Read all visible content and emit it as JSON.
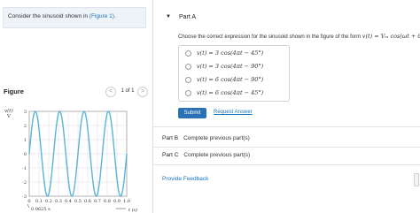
{
  "intro": {
    "text_before": "Consider the sinusoid shown in ",
    "figure_link": "(Figure 1)",
    "text_after": "."
  },
  "figure": {
    "title": "Figure",
    "pager_prev": "<",
    "pager_label": "1 of 1",
    "pager_next": ">"
  },
  "chart_data": {
    "type": "line",
    "ylabel_top": "v(t)",
    "ylabel_unit": "V",
    "xlabel": "t (s)",
    "xlim": [
      0,
      1.0
    ],
    "ylim": [
      -3,
      3
    ],
    "x_ticks": [
      "0",
      "0.1",
      "0.2",
      "0.3",
      "0.4",
      "0.5",
      "0.6",
      "0.7",
      "0.8",
      "0.9",
      "1.0"
    ],
    "y_ticks": [
      "3",
      "2",
      "1",
      "0",
      "-1",
      "-2",
      "-3"
    ],
    "annotation": "0.0625 s",
    "amplitude": 3,
    "frequency_hz": 4,
    "phase_shift_s": 0.0625,
    "grid": true,
    "line_color": "#5ab4d6"
  },
  "part_a": {
    "caret": "▼",
    "title": "Part A",
    "question_prefix": "Choose the correct expression for the sinusoid shown in the figure of the form",
    "question_eq": "v(t) = Vₘ cos(ωt + θ)",
    "question_suffix": ".",
    "options": [
      "v(t) = 3 cos(4πt − 45°)",
      "v(t) = 3 cos(4πt − 90°)",
      "v(t) = 6 cos(4πt − 90°)",
      "v(t) = 6 cos(4πt − 45°)"
    ],
    "submit_label": "Submit",
    "request_label": "Request Answer"
  },
  "part_b": {
    "name": "Part B",
    "status": "Complete previous part(s)"
  },
  "part_c": {
    "name": "Part C",
    "status": "Complete previous part(s)"
  },
  "feedback_label": "Provide Feedback",
  "colors": {
    "accent": "#2a72b5",
    "link": "#1a74b8",
    "intro_bg": "#eef3f8"
  }
}
